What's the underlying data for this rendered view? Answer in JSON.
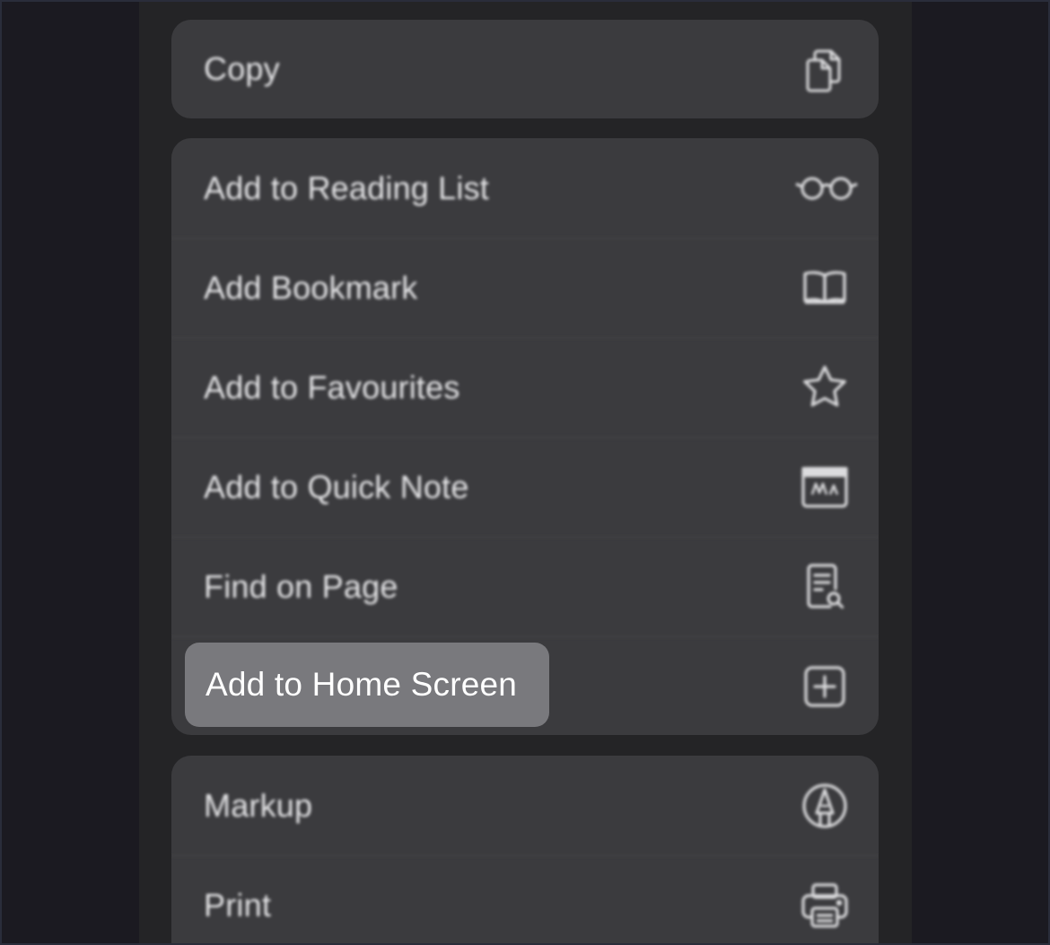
{
  "groups": [
    {
      "items": [
        {
          "label": "Copy",
          "icon": "copy-icon"
        }
      ]
    },
    {
      "items": [
        {
          "label": "Add to Reading List",
          "icon": "glasses-icon"
        },
        {
          "label": "Add Bookmark",
          "icon": "book-icon"
        },
        {
          "label": "Add to Favourites",
          "icon": "star-icon"
        },
        {
          "label": "Add to Quick Note",
          "icon": "quick-note-icon"
        },
        {
          "label": "Find on Page",
          "icon": "find-document-icon"
        },
        {
          "label": "",
          "icon": "plus-square-icon"
        }
      ]
    },
    {
      "items": [
        {
          "label": "Markup",
          "icon": "markup-pen-icon"
        },
        {
          "label": "Print",
          "icon": "printer-icon"
        }
      ]
    }
  ],
  "highlight": {
    "label": "Add to Home Screen"
  },
  "colors": {
    "background": "#1b1a21",
    "sheet": "#242426",
    "group": "#3b3b3e",
    "highlight": "#79797d",
    "text": "#e6e6e8"
  }
}
